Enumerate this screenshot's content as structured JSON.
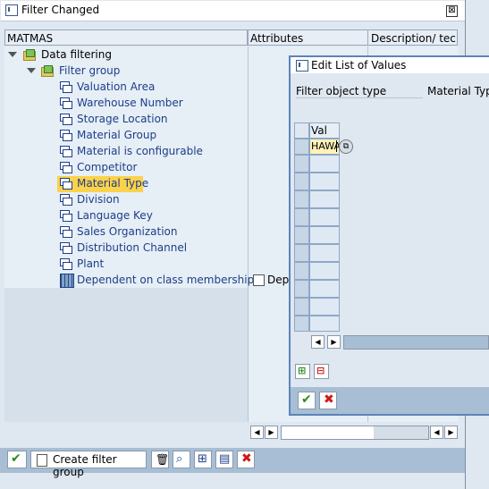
{
  "window": {
    "title": "Filter Changed",
    "close_symbol": "⊠"
  },
  "columns": {
    "col1": "MATMAS",
    "col2": "Attributes",
    "col3": "Description/ tec"
  },
  "tree": {
    "root_label": "Data filtering",
    "group_label": "Filter group",
    "items": [
      "Valuation Area",
      "Warehouse Number",
      "Storage Location",
      "Material Group",
      "Material is configurable",
      "Competitor",
      "Material Type",
      "Division",
      "Language Key",
      "Sales Organization",
      "Distribution Channel",
      "Plant",
      "Dependent on class membership"
    ],
    "selected_item": "Material Type",
    "attr_checkbox_label": "Dep"
  },
  "toolbar": {
    "create_filter_group_label": "Create filter group"
  },
  "dialog": {
    "title": "Edit List of Values",
    "field_label": "Filter object type",
    "field_value": "Material Type",
    "table_header": "Val",
    "table_values": [
      "HAWA"
    ]
  },
  "colors": {
    "selected_row": "#fbd24b",
    "toolbar_bg": "#a8bed4",
    "tree_text": "#1d3e88"
  }
}
